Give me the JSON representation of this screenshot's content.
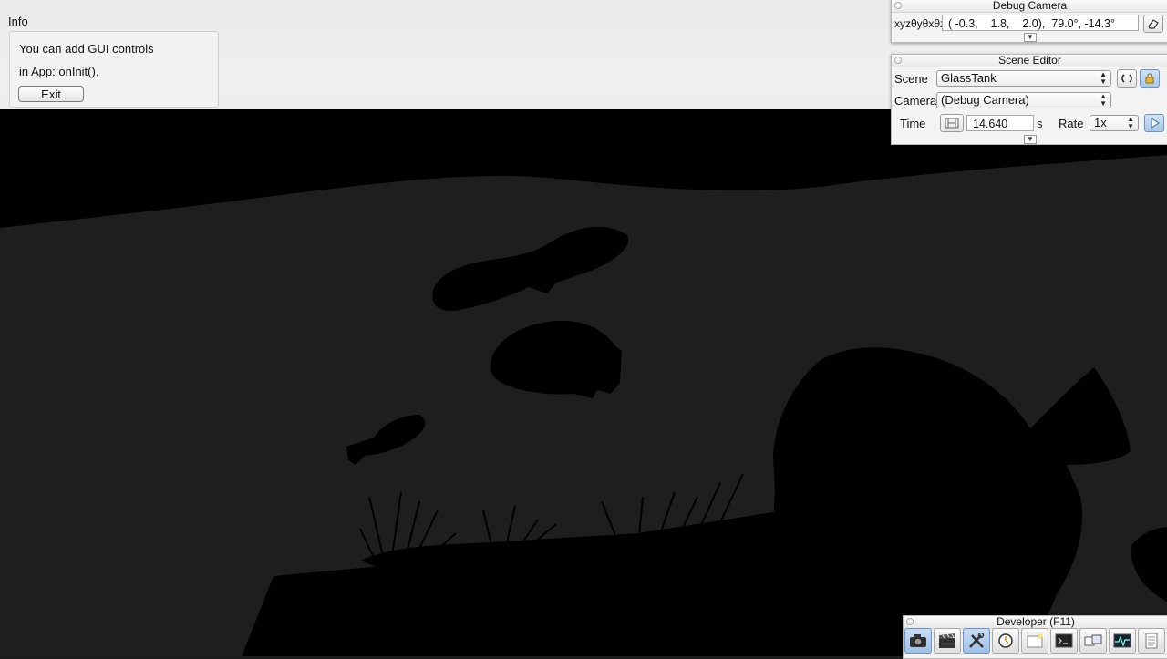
{
  "info": {
    "title": "Info",
    "line1": "You can add GUI controls",
    "line2": "in App::onInit().",
    "exit_label": "Exit"
  },
  "debug_camera": {
    "title": "Debug Camera",
    "coord_label": "xyzθyθxθz",
    "coords": "( -0.3,    1.8,    2.0),  79.0°, -14.3°"
  },
  "scene_editor": {
    "title": "Scene Editor",
    "scene_label": "Scene",
    "scene_value": "GlassTank",
    "camera_label": "Camera",
    "camera_value": "(Debug Camera)",
    "time_label": "Time",
    "time_value": "14.640",
    "time_unit": "s",
    "rate_label": "Rate",
    "rate_value": "1x"
  },
  "developer": {
    "title": "Developer (F11)",
    "tools": [
      {
        "icon": "camera-icon",
        "active": true
      },
      {
        "icon": "clapperboard-icon",
        "active": false
      },
      {
        "icon": "wrench-screwdriver-icon",
        "active": true
      },
      {
        "icon": "clock-icon",
        "active": false
      },
      {
        "icon": "scene-folder-icon",
        "active": false
      },
      {
        "icon": "terminal-icon",
        "active": false
      },
      {
        "icon": "windows-icon",
        "active": false
      },
      {
        "icon": "profiler-icon",
        "active": false
      },
      {
        "icon": "log-page-icon",
        "active": false
      }
    ]
  },
  "colors": {
    "scene_background": "#1d1d1d",
    "silhouette": "#000000",
    "panel_background": "#efefef",
    "active_button": "#a9c8e8"
  }
}
